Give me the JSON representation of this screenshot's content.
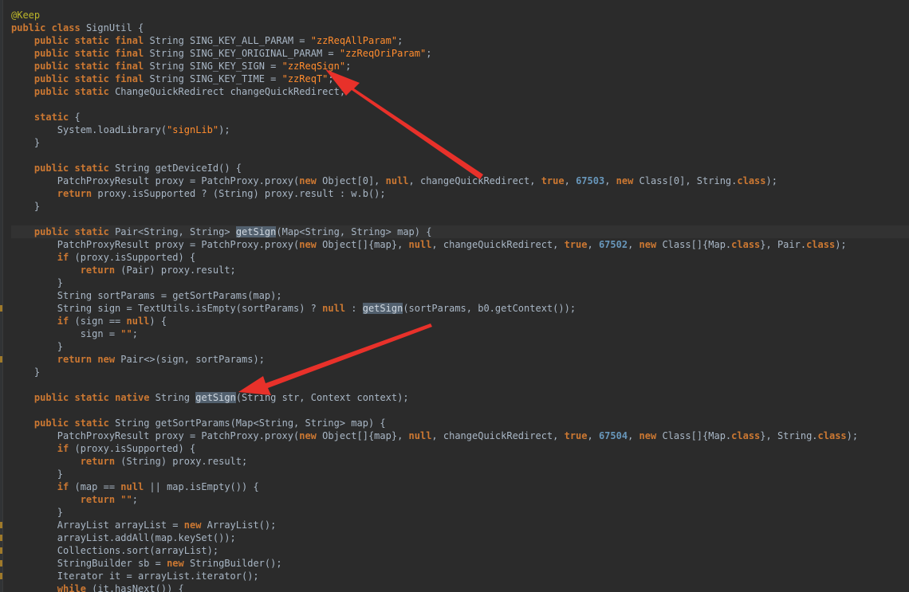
{
  "editor": {
    "language": "Java",
    "theme_colors": {
      "background": "#2b2b2b",
      "keyword": "#cc7832",
      "string": "#6a8759",
      "number": "#6897bb",
      "text": "#a9b7c6",
      "annotation_arrow": "#e8312a"
    },
    "annotation": {
      "arrow_count": 2,
      "targets": [
        "zzReqSign",
        "getSign"
      ]
    },
    "lines": [
      {
        "tokens": [
          [
            "@Keep",
            "ann"
          ]
        ]
      },
      {
        "tokens": [
          [
            "public",
            "kw"
          ],
          [
            " "
          ],
          [
            "class",
            "kw"
          ],
          [
            " SignUtil {"
          ]
        ]
      },
      {
        "tokens": [
          [
            "    "
          ],
          [
            "public",
            "kw"
          ],
          [
            " "
          ],
          [
            "static",
            "kw"
          ],
          [
            " "
          ],
          [
            "final",
            "kw"
          ],
          [
            " String SING_KEY_ALL_PARAM = "
          ],
          [
            "\"zzReqAllParam\"",
            "str hl"
          ],
          [
            ";"
          ]
        ]
      },
      {
        "tokens": [
          [
            "    "
          ],
          [
            "public",
            "kw"
          ],
          [
            " "
          ],
          [
            "static",
            "kw"
          ],
          [
            " "
          ],
          [
            "final",
            "kw"
          ],
          [
            " String SING_KEY_ORIGINAL_PARAM = "
          ],
          [
            "\"zzReqOriParam\"",
            "str hl"
          ],
          [
            ";"
          ]
        ]
      },
      {
        "tokens": [
          [
            "    "
          ],
          [
            "public",
            "kw"
          ],
          [
            " "
          ],
          [
            "static",
            "kw"
          ],
          [
            " "
          ],
          [
            "final",
            "kw"
          ],
          [
            " String SING_KEY_SIGN = "
          ],
          [
            "\"zzReqSign\"",
            "str hl"
          ],
          [
            ";"
          ]
        ]
      },
      {
        "tokens": [
          [
            "    "
          ],
          [
            "public",
            "kw"
          ],
          [
            " "
          ],
          [
            "static",
            "kw"
          ],
          [
            " "
          ],
          [
            "final",
            "kw"
          ],
          [
            " String SING_KEY_TIME = "
          ],
          [
            "\"zzReqT\"",
            "str hl"
          ],
          [
            ";"
          ]
        ]
      },
      {
        "tokens": [
          [
            "    "
          ],
          [
            "public",
            "kw"
          ],
          [
            " "
          ],
          [
            "static",
            "kw"
          ],
          [
            " ChangeQuickRedirect changeQuickRedirect;"
          ]
        ]
      },
      {
        "tokens": []
      },
      {
        "tokens": [
          [
            "    "
          ],
          [
            "static",
            "kw"
          ],
          [
            " {"
          ]
        ]
      },
      {
        "tokens": [
          [
            "        System.loadLibrary("
          ],
          [
            "\"signLib\"",
            "str hl"
          ],
          [
            ");"
          ]
        ]
      },
      {
        "tokens": [
          [
            "    }"
          ]
        ]
      },
      {
        "tokens": []
      },
      {
        "tokens": [
          [
            "    "
          ],
          [
            "public",
            "kw"
          ],
          [
            " "
          ],
          [
            "static",
            "kw"
          ],
          [
            " String getDeviceId() {"
          ]
        ]
      },
      {
        "tokens": [
          [
            "        PatchProxyResult proxy = PatchProxy.proxy("
          ],
          [
            "new",
            "kw"
          ],
          [
            " Object[0], "
          ],
          [
            "null",
            "kw"
          ],
          [
            ", changeQuickRedirect, "
          ],
          [
            "true",
            "kw"
          ],
          [
            ", "
          ],
          [
            "67503",
            "num"
          ],
          [
            ", "
          ],
          [
            "new",
            "kw"
          ],
          [
            " Class[0], String."
          ],
          [
            "class",
            "kw"
          ],
          [
            ");"
          ]
        ]
      },
      {
        "tokens": [
          [
            "        "
          ],
          [
            "return",
            "kw"
          ],
          [
            " proxy.isSupported ? (String) proxy.result : w.b();"
          ]
        ]
      },
      {
        "tokens": [
          [
            "    }"
          ]
        ]
      },
      {
        "tokens": []
      },
      {
        "current": true,
        "tokens": [
          [
            "    "
          ],
          [
            "public",
            "kw"
          ],
          [
            " "
          ],
          [
            "static",
            "kw"
          ],
          [
            " Pair<String, String> "
          ],
          [
            "getSign",
            "mhl"
          ],
          [
            "(Map<String, String> map) {"
          ]
        ]
      },
      {
        "tokens": [
          [
            "        PatchProxyResult proxy = PatchProxy.proxy("
          ],
          [
            "new",
            "kw"
          ],
          [
            " Object[]{map}, "
          ],
          [
            "null",
            "kw"
          ],
          [
            ", changeQuickRedirect, "
          ],
          [
            "true",
            "kw"
          ],
          [
            ", "
          ],
          [
            "67502",
            "num"
          ],
          [
            ", "
          ],
          [
            "new",
            "kw"
          ],
          [
            " Class[]{Map."
          ],
          [
            "class",
            "kw"
          ],
          [
            "}, Pair."
          ],
          [
            "class",
            "kw"
          ],
          [
            ");"
          ]
        ]
      },
      {
        "tokens": [
          [
            "        "
          ],
          [
            "if",
            "kw"
          ],
          [
            " (proxy.isSupported) {"
          ]
        ]
      },
      {
        "tokens": [
          [
            "            "
          ],
          [
            "return",
            "kw"
          ],
          [
            " (Pair) proxy.result;"
          ]
        ]
      },
      {
        "tokens": [
          [
            "        }"
          ]
        ]
      },
      {
        "tokens": [
          [
            "        String sortParams = getSortParams(map);"
          ]
        ]
      },
      {
        "marker": true,
        "tokens": [
          [
            "        String sign = TextUtils.isEmpty(sortParams) ? "
          ],
          [
            "null",
            "kw"
          ],
          [
            " : "
          ],
          [
            "getSign",
            "mhl"
          ],
          [
            "(sortParams, b0.getContext());"
          ]
        ]
      },
      {
        "tokens": [
          [
            "        "
          ],
          [
            "if",
            "kw"
          ],
          [
            " (sign == "
          ],
          [
            "null",
            "kw"
          ],
          [
            ") {"
          ]
        ]
      },
      {
        "tokens": [
          [
            "            sign = "
          ],
          [
            "\"\"",
            "str hl"
          ],
          [
            ";"
          ]
        ]
      },
      {
        "tokens": [
          [
            "        }"
          ]
        ]
      },
      {
        "marker": true,
        "tokens": [
          [
            "        "
          ],
          [
            "return",
            "kw"
          ],
          [
            " "
          ],
          [
            "new",
            "kw"
          ],
          [
            " Pair<>(sign, sortParams);"
          ]
        ]
      },
      {
        "tokens": [
          [
            "    }"
          ]
        ]
      },
      {
        "tokens": []
      },
      {
        "tokens": [
          [
            "    "
          ],
          [
            "public",
            "kw"
          ],
          [
            " "
          ],
          [
            "static",
            "kw"
          ],
          [
            " "
          ],
          [
            "native",
            "kw"
          ],
          [
            " String "
          ],
          [
            "getSign",
            "mhl"
          ],
          [
            "(String str, Context context);"
          ]
        ]
      },
      {
        "tokens": []
      },
      {
        "tokens": [
          [
            "    "
          ],
          [
            "public",
            "kw"
          ],
          [
            " "
          ],
          [
            "static",
            "kw"
          ],
          [
            " String getSortParams(Map<String, String> map) {"
          ]
        ]
      },
      {
        "tokens": [
          [
            "        PatchProxyResult proxy = PatchProxy.proxy("
          ],
          [
            "new",
            "kw"
          ],
          [
            " Object[]{map}, "
          ],
          [
            "null",
            "kw"
          ],
          [
            ", changeQuickRedirect, "
          ],
          [
            "true",
            "kw"
          ],
          [
            ", "
          ],
          [
            "67504",
            "num"
          ],
          [
            ", "
          ],
          [
            "new",
            "kw"
          ],
          [
            " Class[]{Map."
          ],
          [
            "class",
            "kw"
          ],
          [
            "}, String."
          ],
          [
            "class",
            "kw"
          ],
          [
            ");"
          ]
        ]
      },
      {
        "tokens": [
          [
            "        "
          ],
          [
            "if",
            "kw"
          ],
          [
            " (proxy.isSupported) {"
          ]
        ]
      },
      {
        "tokens": [
          [
            "            "
          ],
          [
            "return",
            "kw"
          ],
          [
            " (String) proxy.result;"
          ]
        ]
      },
      {
        "tokens": [
          [
            "        }"
          ]
        ]
      },
      {
        "tokens": [
          [
            "        "
          ],
          [
            "if",
            "kw"
          ],
          [
            " (map == "
          ],
          [
            "null",
            "kw"
          ],
          [
            " || map.isEmpty()) {"
          ]
        ]
      },
      {
        "tokens": [
          [
            "            "
          ],
          [
            "return",
            "kw"
          ],
          [
            " "
          ],
          [
            "\"\"",
            "str hl"
          ],
          [
            ";"
          ]
        ]
      },
      {
        "tokens": [
          [
            "        }"
          ]
        ]
      },
      {
        "marker": true,
        "tokens": [
          [
            "        ArrayList arrayList = "
          ],
          [
            "new",
            "kw"
          ],
          [
            " ArrayList();"
          ]
        ]
      },
      {
        "marker": true,
        "tokens": [
          [
            "        arrayList.addAll(map.keySet());"
          ]
        ]
      },
      {
        "marker": true,
        "tokens": [
          [
            "        Collections.sort(arrayList);"
          ]
        ]
      },
      {
        "marker": true,
        "tokens": [
          [
            "        StringBuilder sb = "
          ],
          [
            "new",
            "kw"
          ],
          [
            " StringBuilder();"
          ]
        ]
      },
      {
        "marker": true,
        "tokens": [
          [
            "        Iterator it = arrayList.iterator();"
          ]
        ]
      },
      {
        "tokens": [
          [
            "        "
          ],
          [
            "while",
            "kw"
          ],
          [
            " (it.hasNext()) {"
          ]
        ]
      }
    ]
  }
}
